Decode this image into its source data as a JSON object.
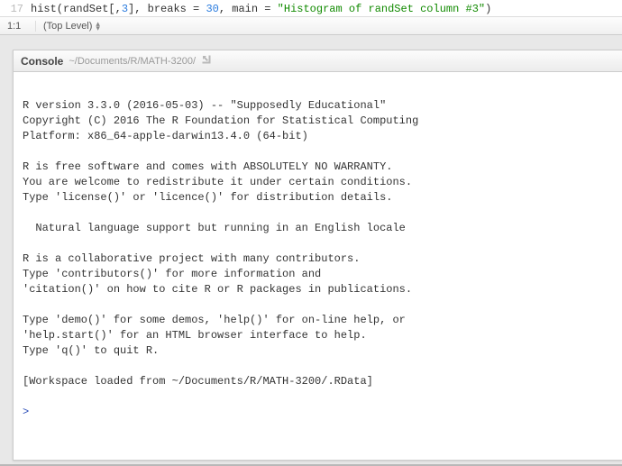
{
  "editor": {
    "lineNumber": "17",
    "codePrefix": "hist(randSet[,",
    "codeNum": "3",
    "codeMid": "], breaks = ",
    "codeNum2": "30",
    "codeMid2": ", main = ",
    "codeStr": "\"Histogram of randSet column #3\"",
    "codeSuffix": ")",
    "cursorPos": "1:1",
    "scopeLabel": "(Top Level)"
  },
  "console": {
    "title": "Console",
    "path": "~/Documents/R/MATH-3200/",
    "output": "\nR version 3.3.0 (2016-05-03) -- \"Supposedly Educational\"\nCopyright (C) 2016 The R Foundation for Statistical Computing\nPlatform: x86_64-apple-darwin13.4.0 (64-bit)\n\nR is free software and comes with ABSOLUTELY NO WARRANTY.\nYou are welcome to redistribute it under certain conditions.\nType 'license()' or 'licence()' for distribution details.\n\n  Natural language support but running in an English locale\n\nR is a collaborative project with many contributors.\nType 'contributors()' for more information and\n'citation()' on how to cite R or R packages in publications.\n\nType 'demo()' for some demos, 'help()' for on-line help, or\n'help.start()' for an HTML browser interface to help.\nType 'q()' to quit R.\n\n[Workspace loaded from ~/Documents/R/MATH-3200/.RData]\n",
    "prompt": ">"
  }
}
